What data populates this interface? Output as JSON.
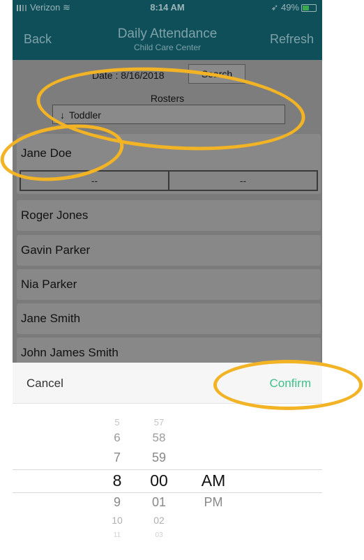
{
  "status_bar": {
    "carrier": "Verizon",
    "time": "8:14 AM",
    "battery": "49%",
    "battery_fill_fraction": 0.49
  },
  "nav": {
    "back_label": "Back",
    "title": "Daily Attendance",
    "subtitle": "Child Care Center",
    "refresh_label": "Refresh"
  },
  "filter": {
    "date_label": "Date : 8/16/2018",
    "search_label": "Search",
    "rosters_label": "Rosters",
    "roster_selected": "Toddler",
    "roster_arrow": "↓"
  },
  "attendees": {
    "expanded": {
      "name": "Jane Doe",
      "time_in": "--",
      "time_out": "--"
    },
    "rows": [
      "Roger Jones",
      "Gavin Parker",
      "Nia Parker",
      "Jane Smith",
      "John James Smith"
    ]
  },
  "time_picker": {
    "cancel_label": "Cancel",
    "confirm_label": "Confirm",
    "hours": [
      "5",
      "6",
      "7",
      "8",
      "9",
      "10",
      "11"
    ],
    "minutes": [
      "57",
      "58",
      "59",
      "00",
      "01",
      "02",
      "03"
    ],
    "ampm": [
      "AM",
      "PM"
    ],
    "selected": {
      "hour": "8",
      "minute": "00",
      "ampm": "AM"
    }
  },
  "colors": {
    "nav_bg": "#0f4f5a",
    "confirm": "#3ec28a",
    "annotation": "#f2b324",
    "overlay": "#7b7b7b"
  }
}
